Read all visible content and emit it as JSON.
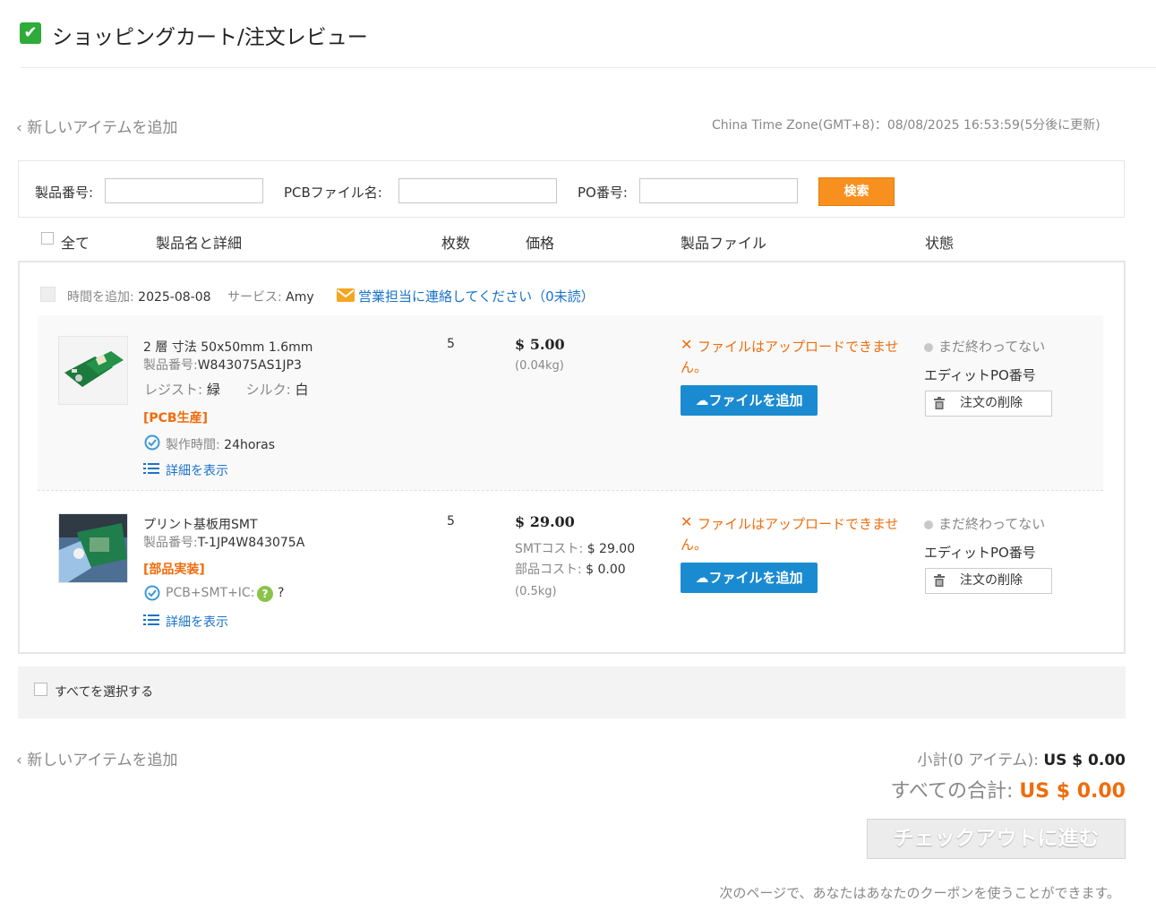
{
  "header": {
    "title": "ショッピングカート/注文レビュー",
    "check_icon": "check-icon"
  },
  "add_item_top": "‹ 新しいアイテムを追加",
  "timezone": "China Time Zone(GMT+8)：08/08/2025 16:53:59(5分後に更新)",
  "search": {
    "product_no_label": "製品番号:",
    "product_no_value": "",
    "pcb_file_label": "PCBファイル名:",
    "pcb_file_value": "",
    "po_label": "PO番号:",
    "po_value": "",
    "button": "検索"
  },
  "table_header": {
    "all": "全て",
    "name": "製品名と詳細",
    "qty": "枚数",
    "price": "価格",
    "file": "製品ファイル",
    "status": "状態"
  },
  "group": {
    "added_label": "時間を追加:",
    "added_value": "2025-08-08",
    "service_label": "サービス:",
    "service_value": "Amy",
    "contact": "営業担当に連絡してください（0未読）"
  },
  "items": [
    {
      "title": "2 層 寸法 50x50mm 1.6mm",
      "product_no_label": "製品番号:",
      "product_no": "W843075AS1JP3",
      "resist_label": "レジスト:",
      "resist": "緑",
      "silk_label": "シルク:",
      "silk": "白",
      "tag": "[PCB生産]",
      "time_label": "製作時間:",
      "time_value": "24horas",
      "details": "詳細を表示",
      "qty": "5",
      "price": "$ 5.00",
      "weight": "(0.04kg)",
      "file_error_1": "ファイルはアップロードできませ",
      "file_error_2": "ん。",
      "add_file": "ファイルを追加",
      "status": "まだ終わってない",
      "edit_po": "エディットPO番号",
      "delete": "注文の削除"
    },
    {
      "title": "プリント基板用SMT",
      "product_no_label": "製品番号:",
      "product_no": "T-1JP4W843075A",
      "tag": "[部品実装]",
      "spec": "PCB+SMT+IC:",
      "spec_q": "?",
      "details": "詳細を表示",
      "qty": "5",
      "price": "$ 29.00",
      "smt_label": "SMTコスト:",
      "smt_value": "$ 29.00",
      "parts_label": "部品コスト:",
      "parts_value": "$ 0.00",
      "weight": "(0.5kg)",
      "file_error_1": "ファイルはアップロードできませ",
      "file_error_2": "ん。",
      "add_file": "ファイルを追加",
      "status": "まだ終わってない",
      "edit_po": "エディットPO番号",
      "delete": "注文の削除"
    }
  ],
  "select_all": "すべてを選択する",
  "add_item_bottom": "‹ 新しいアイテムを追加",
  "subtotal_label": "小計(0 アイテム):",
  "subtotal_value": "US $ 0.00",
  "total_label": "すべての合計:",
  "total_value": "US $ 0.00",
  "checkout": "チェックアウトに進む",
  "coupon_note": "次のページで、あなたはあなたのクーポンを使うことができます。",
  "colors": {
    "orange": "#f7901e",
    "blue": "#1b8bd1",
    "link": "#1a73c8",
    "error": "#ef6c0c"
  }
}
